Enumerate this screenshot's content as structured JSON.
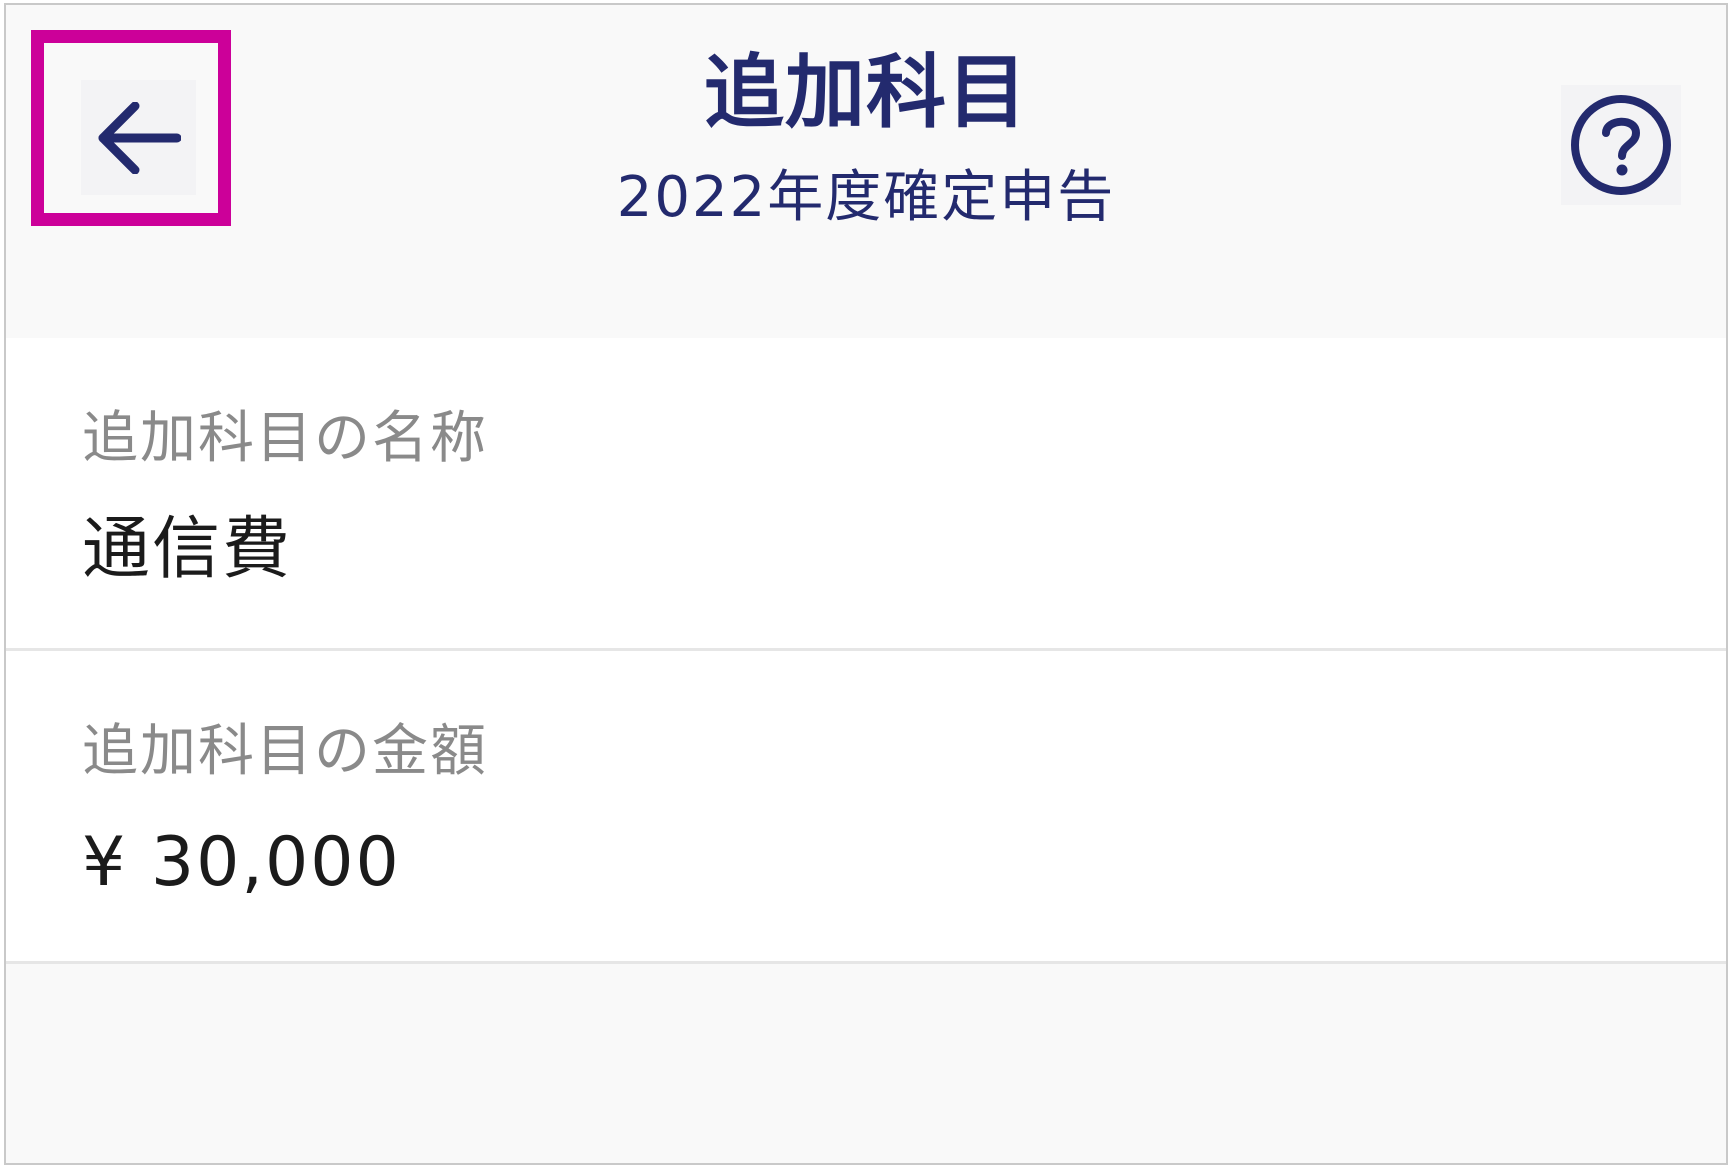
{
  "header": {
    "title": "追加科目",
    "subtitle": "2022年度確定申告",
    "back_icon": "arrow-left-icon",
    "help_icon": "question-circle-icon"
  },
  "fields": [
    {
      "label": "追加科目の名称",
      "value": "通信費"
    },
    {
      "label": "追加科目の金額",
      "value": "¥ 30,000"
    }
  ],
  "colors": {
    "primary": "#232a6e",
    "highlight": "#cc0099",
    "label": "#8a8a8a",
    "value": "#1b1b1b",
    "background": "#f9f9f9"
  }
}
